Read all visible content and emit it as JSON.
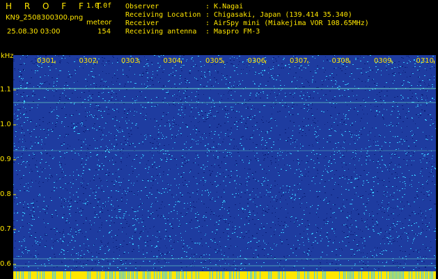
{
  "header": {
    "app_name": "H R O F F T",
    "version": "1.0.0f",
    "filename": "KN9_2508300300.png",
    "subtitle": "meteor",
    "datetime": "25.08.30 03:00",
    "count": "154"
  },
  "info": [
    {
      "label": "Observer",
      "value": ": K.Nagai"
    },
    {
      "label": "Receiving Location",
      "value": ": Chigasaki, Japan (139.414 35.340)"
    },
    {
      "label": "Receiver",
      "value": ": AirSpy mini (Miakejima VOR 108.65MHz)"
    },
    {
      "label": "Receiving antenna",
      "value": ": Maspro FM-3"
    }
  ],
  "spectrogram": {
    "unit_label": "kHz",
    "y_ticks": [
      "1.1",
      "1.0",
      "0.9",
      "0.8",
      "0.7",
      "0.6"
    ],
    "x_ticks": [
      "0301",
      "0302",
      "0303",
      "0304",
      "0305",
      "0306",
      "0307",
      "0308",
      "0309",
      "0310"
    ],
    "colors": {
      "background": "#1e3ca0",
      "noise_light": "#38c8ff",
      "noise_dark": "#0a1e78",
      "line": "#80ffd0",
      "bottom_bar": "#ffe600"
    }
  }
}
